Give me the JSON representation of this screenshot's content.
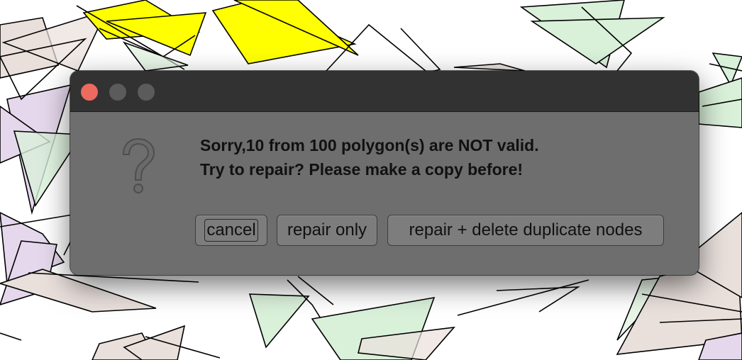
{
  "window": {
    "traffic_lights": [
      "close",
      "minimize",
      "zoom"
    ],
    "icon": "question-mark-icon"
  },
  "message": {
    "line1": "Sorry,10 from 100 polygon(s) are NOT valid.",
    "line2": "Try to repair? Please make a copy before!"
  },
  "buttons": {
    "cancel": "cancel",
    "repair_only": "repair only",
    "repair_delete": "repair + delete duplicate nodes"
  },
  "colors": {
    "close_button": "#ed6a5e",
    "dialog_bg": "#6e6e6e",
    "titlebar_bg": "#323232",
    "polygon_yellow": "#ffff00",
    "polygon_green": "#d9f0d9",
    "polygon_purple": "#e5d8ec",
    "polygon_brown": "#e9e0dc"
  }
}
